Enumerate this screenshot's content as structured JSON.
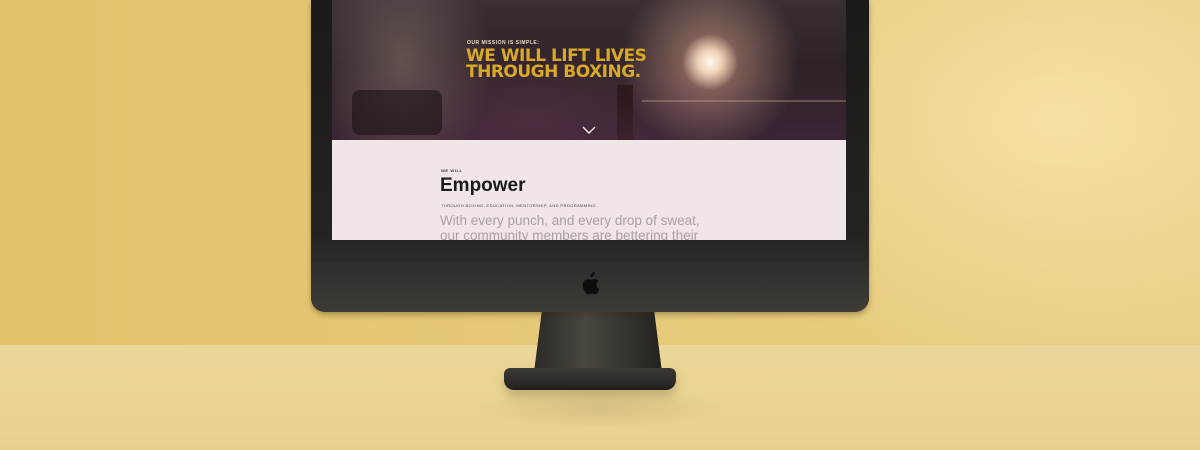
{
  "hero": {
    "kicker": "OUR MISSION IS SIMPLE:",
    "title": "WE WILL LIFT LIVES THROUGH BOXING."
  },
  "section": {
    "kicker": "WE WILL",
    "heading": "Empower",
    "subhead": "THROUGH BOXING, EDUCATION, MENTORSHIP, AND PROGRAMMING.",
    "body": "With every punch, and every drop of sweat, our community members are bettering their"
  },
  "icons": {
    "scroll": "chevron-down-icon",
    "brand": "apple-logo-icon"
  },
  "colors": {
    "accent": "#d9a928",
    "section_bg": "#f1e6e6",
    "background": "#e6c97a"
  }
}
